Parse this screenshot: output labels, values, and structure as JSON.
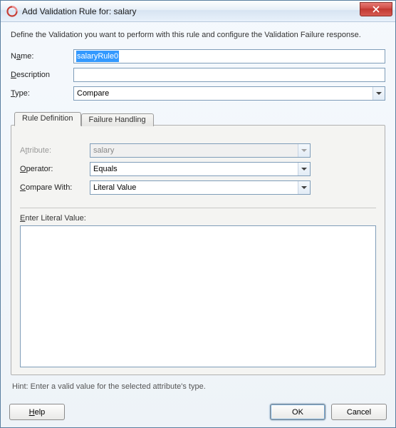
{
  "titlebar": {
    "title": "Add Validation Rule for: salary"
  },
  "intro": "Define the Validation you want to perform with this rule and configure the Validation Failure response.",
  "fields": {
    "name": {
      "label_pre": "N",
      "label_u": "a",
      "label_post": "me:",
      "value": "salaryRule0"
    },
    "description": {
      "label_pre": "",
      "label_u": "D",
      "label_post": "escription",
      "value": ""
    },
    "type": {
      "label_pre": "",
      "label_u": "T",
      "label_post": "ype:",
      "value": "Compare"
    }
  },
  "tabs": {
    "definition": "Rule Definition",
    "failure": "Failure Handling"
  },
  "ruledef": {
    "attribute": {
      "label_pre": "A",
      "label_u": "t",
      "label_post": "tribute:",
      "value": "salary"
    },
    "operator": {
      "label_pre": "",
      "label_u": "O",
      "label_post": "perator:",
      "value": "Equals"
    },
    "compare_with": {
      "label_pre": "",
      "label_u": "C",
      "label_post": "ompare With:",
      "value": "Literal Value"
    },
    "literal": {
      "label_pre": "",
      "label_u": "E",
      "label_post": "nter Literal Value:",
      "value": ""
    }
  },
  "hint": "Hint: Enter a valid value for the selected attribute's type.",
  "buttons": {
    "help": "Help",
    "ok": "OK",
    "cancel": "Cancel"
  }
}
